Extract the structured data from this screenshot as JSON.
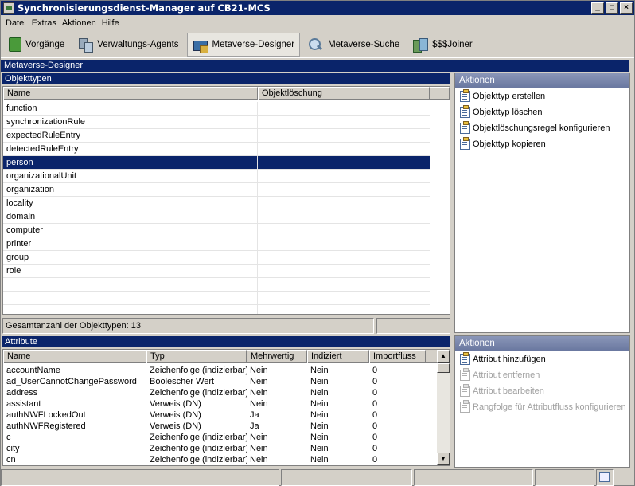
{
  "window": {
    "title": "Synchronisierungsdienst-Manager auf CB21-MCS",
    "controls": {
      "minimize": "_",
      "maximize": "□",
      "close": "×"
    }
  },
  "menu": [
    "Datei",
    "Extras",
    "Aktionen",
    "Hilfe"
  ],
  "toolbar": [
    {
      "label": "Vorgänge",
      "icon": "operations-icon",
      "active": false
    },
    {
      "label": "Verwaltungs-Agents",
      "icon": "management-agents-icon",
      "active": false
    },
    {
      "label": "Metaverse-Designer",
      "icon": "metaverse-designer-icon",
      "active": true
    },
    {
      "label": "Metaverse-Suche",
      "icon": "metaverse-search-icon",
      "active": false
    },
    {
      "label": "$$$Joiner",
      "icon": "joiner-icon",
      "active": false
    }
  ],
  "section_title": "Metaverse-Designer",
  "object_types": {
    "header": "Objekttypen",
    "columns": [
      "Name",
      "Objektlöschung"
    ],
    "rows": [
      "function",
      "synchronizationRule",
      "expectedRuleEntry",
      "detectedRuleEntry",
      "person",
      "organizationalUnit",
      "organization",
      "locality",
      "domain",
      "computer",
      "printer",
      "group",
      "role"
    ],
    "selected": "person",
    "total_label": "Gesamtanzahl der Objekttypen: 13"
  },
  "object_actions": {
    "header": "Aktionen",
    "items": [
      {
        "label": "Objekttyp erstellen",
        "enabled": true
      },
      {
        "label": "Objekttyp löschen",
        "enabled": true
      },
      {
        "label": "Objektlöschungsregel konfigurieren",
        "enabled": true
      },
      {
        "label": "Objekttyp kopieren",
        "enabled": true
      }
    ]
  },
  "attributes": {
    "header": "Attribute",
    "columns": [
      "Name",
      "Typ",
      "Mehrwertig",
      "Indiziert",
      "Importfluss"
    ],
    "rows": [
      [
        "accountName",
        "Zeichenfolge (indizierbar)",
        "Nein",
        "Nein",
        "0"
      ],
      [
        "ad_UserCannotChangePassword",
        "Boolescher Wert",
        "Nein",
        "Nein",
        "0"
      ],
      [
        "address",
        "Zeichenfolge (indizierbar)",
        "Nein",
        "Nein",
        "0"
      ],
      [
        "assistant",
        "Verweis (DN)",
        "Nein",
        "Nein",
        "0"
      ],
      [
        "authNWFLockedOut",
        "Verweis (DN)",
        "Ja",
        "Nein",
        "0"
      ],
      [
        "authNWFRegistered",
        "Verweis (DN)",
        "Ja",
        "Nein",
        "0"
      ],
      [
        "c",
        "Zeichenfolge (indizierbar)",
        "Nein",
        "Nein",
        "0"
      ],
      [
        "city",
        "Zeichenfolge (indizierbar)",
        "Nein",
        "Nein",
        "0"
      ],
      [
        "cn",
        "Zeichenfolge (indizierbar)",
        "Nein",
        "Nein",
        "0"
      ]
    ]
  },
  "attribute_actions": {
    "header": "Aktionen",
    "items": [
      {
        "label": "Attribut hinzufügen",
        "enabled": true
      },
      {
        "label": "Attribut entfernen",
        "enabled": false
      },
      {
        "label": "Attribut bearbeiten",
        "enabled": false
      },
      {
        "label": "Rangfolge für Attributfluss konfigurieren",
        "enabled": false
      }
    ]
  }
}
